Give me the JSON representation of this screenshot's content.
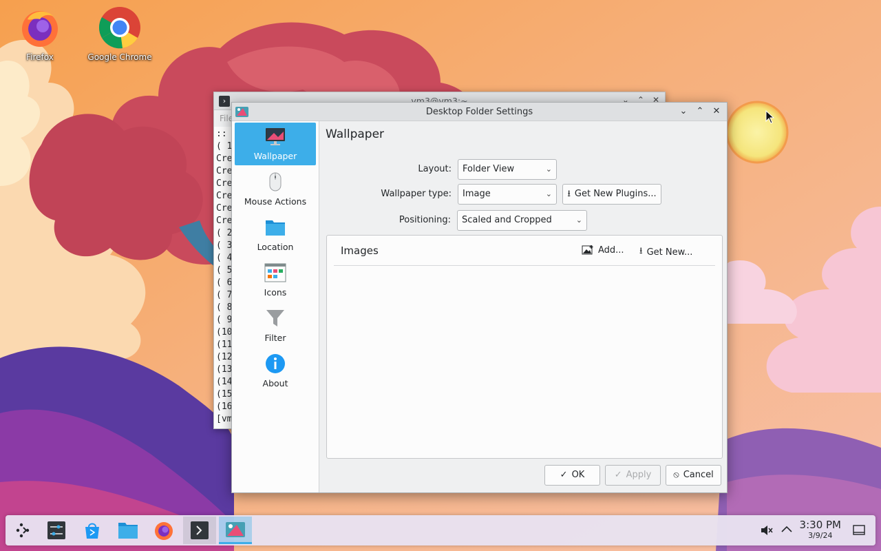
{
  "desktop": {
    "icons": [
      {
        "label": "Firefox",
        "icon": "firefox-icon"
      },
      {
        "label": "Google Chrome",
        "icon": "chrome-icon"
      }
    ]
  },
  "terminal": {
    "title": "vm3@vm3:~",
    "menu_label": "File",
    "lines": "::\n( 1\nCre\nCre\nCre\nCre\nCre\nCre\n( 2\n( 3\n( 4\n( 5\n( 6\n( 7\n( 8\n( 9\n(10\n(11\n(12\n(13\n(14\n(15\n(16\n[vm"
  },
  "dialog": {
    "title": "Desktop Folder Settings",
    "sidebar": [
      {
        "label": "Wallpaper",
        "icon": "monitor-icon",
        "active": true
      },
      {
        "label": "Mouse Actions",
        "icon": "mouse-icon"
      },
      {
        "label": "Location",
        "icon": "folder-icon"
      },
      {
        "label": "Icons",
        "icon": "icons-view-icon"
      },
      {
        "label": "Filter",
        "icon": "funnel-icon"
      },
      {
        "label": "About",
        "icon": "info-icon"
      }
    ],
    "page_title": "Wallpaper",
    "layout": {
      "label": "Layout:",
      "value": "Folder View"
    },
    "wallpaper_type": {
      "label": "Wallpaper type:",
      "value": "Image"
    },
    "get_new_plugins": "Get New Plugins...",
    "positioning": {
      "label": "Positioning:",
      "value": "Scaled and Cropped"
    },
    "images": {
      "title": "Images",
      "add": "Add...",
      "get_new": "Get New..."
    },
    "buttons": {
      "ok": "OK",
      "apply": "Apply",
      "cancel": "Cancel"
    }
  },
  "taskbar": {
    "time": "3:30 PM",
    "date": "3/9/24",
    "items": [
      "app-launcher-icon",
      "system-settings-icon",
      "discover-store-icon",
      "file-manager-icon",
      "firefox-icon",
      "terminal-icon",
      "desktop-settings-icon"
    ]
  },
  "colors": {
    "accent": "#3daee9",
    "window_bg": "#eff0f1",
    "view_bg": "#fcfcfc"
  }
}
